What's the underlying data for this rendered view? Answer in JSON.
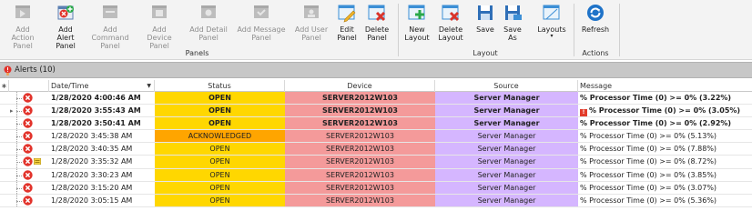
{
  "ribbon": {
    "panels_group": "Panels",
    "layout_group": "Layout",
    "actions_group": "Actions",
    "buttons": {
      "add_action_panel": [
        "Add Action",
        "Panel"
      ],
      "add_alert_panel": [
        "Add Alert",
        "Panel"
      ],
      "add_command_panel": [
        "Add Command",
        "Panel"
      ],
      "add_device_panel": [
        "Add Device",
        "Panel"
      ],
      "add_detail_panel": [
        "Add Detail",
        "Panel"
      ],
      "add_message_panel": [
        "Add Message",
        "Panel"
      ],
      "add_user_panel": [
        "Add User",
        "Panel"
      ],
      "edit_panel": [
        "Edit",
        "Panel"
      ],
      "delete_panel": [
        "Delete",
        "Panel"
      ],
      "new_layout": [
        "New",
        "Layout"
      ],
      "delete_layout": [
        "Delete",
        "Layout"
      ],
      "save": [
        "Save",
        ""
      ],
      "save_as": [
        "Save",
        "As"
      ],
      "layouts": [
        "Layouts",
        "▾"
      ],
      "refresh": [
        "Refresh",
        ""
      ]
    }
  },
  "alerts_bar": {
    "title": "Alerts (10)"
  },
  "grid": {
    "columns": {
      "datetime": "Date/Time",
      "status": "Status",
      "device": "Device",
      "source": "Source",
      "message": "Message"
    },
    "sort_indicator": "▼",
    "rows": [
      {
        "datetime": "1/28/2020 4:00:46 AM",
        "status": "OPEN",
        "device": "SERVER2012W103",
        "source": "Server Manager",
        "message": "% Processor Time (0) >= 0% (3.22%)",
        "bold": true,
        "note": false,
        "msg_flag": false,
        "expand": false
      },
      {
        "datetime": "1/28/2020 3:55:43 AM",
        "status": "OPEN",
        "device": "SERVER2012W103",
        "source": "Server Manager",
        "message": "% Processor Time (0) >= 0% (3.05%)",
        "bold": true,
        "note": false,
        "msg_flag": true,
        "expand": true
      },
      {
        "datetime": "1/28/2020 3:50:41 AM",
        "status": "OPEN",
        "device": "SERVER2012W103",
        "source": "Server Manager",
        "message": "% Processor Time (0) >= 0% (2.92%)",
        "bold": true,
        "note": false,
        "msg_flag": false,
        "expand": false
      },
      {
        "datetime": "1/28/2020 3:45:38 AM",
        "status": "ACKNOWLEDGED",
        "device": "SERVER2012W103",
        "source": "Server Manager",
        "message": "% Processor Time (0) >= 0% (5.13%)",
        "bold": false,
        "note": false,
        "msg_flag": false,
        "expand": false
      },
      {
        "datetime": "1/28/2020 3:40:35 AM",
        "status": "OPEN",
        "device": "SERVER2012W103",
        "source": "Server Manager",
        "message": "% Processor Time (0) >= 0% (7.88%)",
        "bold": false,
        "note": false,
        "msg_flag": false,
        "expand": false
      },
      {
        "datetime": "1/28/2020 3:35:32 AM",
        "status": "OPEN",
        "device": "SERVER2012W103",
        "source": "Server Manager",
        "message": "% Processor Time (0) >= 0% (8.72%)",
        "bold": false,
        "note": true,
        "msg_flag": false,
        "expand": false
      },
      {
        "datetime": "1/28/2020 3:30:23 AM",
        "status": "OPEN",
        "device": "SERVER2012W103",
        "source": "Server Manager",
        "message": "% Processor Time (0) >= 0% (3.85%)",
        "bold": false,
        "note": false,
        "msg_flag": false,
        "expand": false
      },
      {
        "datetime": "1/28/2020 3:15:20 AM",
        "status": "OPEN",
        "device": "SERVER2012W103",
        "source": "Server Manager",
        "message": "% Processor Time (0) >= 0% (3.07%)",
        "bold": false,
        "note": false,
        "msg_flag": false,
        "expand": false
      },
      {
        "datetime": "1/28/2020 3:05:15 AM",
        "status": "OPEN",
        "device": "SERVER2012W103",
        "source": "Server Manager",
        "message": "% Processor Time (0) >= 0% (5.36%)",
        "bold": false,
        "note": false,
        "msg_flag": false,
        "expand": false
      }
    ]
  },
  "colors": {
    "status_open": "#ffd700",
    "status_acknowledged": "#ffa500",
    "device": "#f49a9a",
    "source": "#d5b6ff",
    "error_icon": "#e2322a"
  },
  "icons": {
    "alerts_bar": "alert-bell-icon",
    "row": "error-x-icon",
    "note": "note-icon"
  }
}
